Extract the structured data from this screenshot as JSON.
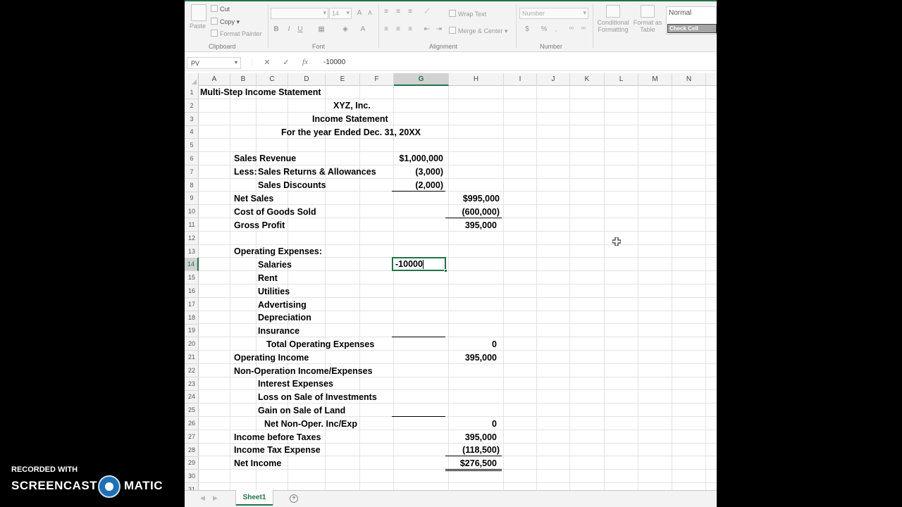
{
  "ribbon": {
    "clipboard": {
      "cut": "Cut",
      "copy": "Copy",
      "paste": "Paste",
      "format_painter": "Format Painter",
      "label": "Clipboard"
    },
    "font": {
      "size": "14",
      "label": "Font",
      "bold": "B",
      "italic": "I",
      "underline": "U",
      "grow": "A",
      "shrink": "A",
      "color": "A"
    },
    "alignment": {
      "wrap_text": "Wrap Text",
      "merge_center": "Merge & Center",
      "label": "Alignment"
    },
    "number": {
      "format": "Number",
      "currency": "$",
      "percent": "%",
      "comma": ",",
      "label": "Number"
    },
    "styles": {
      "conditional_formatting_1": "Conditional",
      "conditional_formatting_2": "Formatting",
      "format_as_table_1": "Format as",
      "format_as_table_2": "Table",
      "normal": "Normal",
      "check_cell": "Check Cell"
    }
  },
  "formula_bar": {
    "name_box": "PV",
    "cancel": "✕",
    "enter": "✓",
    "fx": "fx",
    "value": "-10000"
  },
  "columns": [
    "A",
    "B",
    "C",
    "D",
    "E",
    "F",
    "G",
    "H",
    "I",
    "J",
    "K",
    "L",
    "M",
    "N"
  ],
  "rows": [
    "1",
    "2",
    "3",
    "4",
    "5",
    "6",
    "7",
    "8",
    "9",
    "10",
    "11",
    "12",
    "13",
    "14",
    "15",
    "16",
    "17",
    "18",
    "19",
    "20",
    "21",
    "22",
    "23",
    "24",
    "25",
    "26",
    "27",
    "28",
    "29",
    "30",
    "31"
  ],
  "sheet": {
    "title": "Multi-Step Income Statement",
    "company": "XYZ, Inc.",
    "statement": "Income Statement",
    "period": "For the year Ended Dec. 31, 20XX",
    "sales_revenue": "Sales Revenue",
    "sales_revenue_val": "$1,000,000",
    "less": "Less:",
    "returns": "Sales Returns & Allowances",
    "returns_val": "(3,000)",
    "discounts": "Sales Discounts",
    "discounts_val": "(2,000)",
    "net_sales": "Net Sales",
    "net_sales_val": "$995,000",
    "cogs": "Cost of Goods Sold",
    "cogs_val": "(600,000)",
    "gross_profit": "Gross Profit",
    "gross_profit_val": "395,000",
    "opex": "Operating Expenses:",
    "salaries": "Salaries",
    "salaries_val": "-10000",
    "rent": "Rent",
    "utilities": "Utilities",
    "advertising": "Advertising",
    "depreciation": "Depreciation",
    "insurance": "Insurance",
    "total_opex": "Total Operating Expenses",
    "total_opex_val": "0",
    "op_income": "Operating Income",
    "op_income_val": "395,000",
    "non_op": "Non-Operation Income/Expenses",
    "interest": "Interest Expenses",
    "loss_inv": "Loss on Sale of Investments",
    "gain_land": "Gain on Sale of Land",
    "net_non_op": "Net Non-Oper. Inc/Exp",
    "net_non_op_val": "0",
    "income_before": "Income before Taxes",
    "income_before_val": "395,000",
    "tax": "Income Tax Expense",
    "tax_val": "(118,500)",
    "net_income": "Net Income",
    "net_income_val": "$276,500"
  },
  "tabs": {
    "sheet1": "Sheet1",
    "add": "+",
    "prev": "◀",
    "next": "▶"
  },
  "watermark": {
    "recorded": "RECORDED WITH",
    "brand_left": "SCREENCAST",
    "brand_right": "MATIC"
  },
  "colors": {
    "excel_green": "#217346",
    "check_cell": "#a5a5a5"
  }
}
